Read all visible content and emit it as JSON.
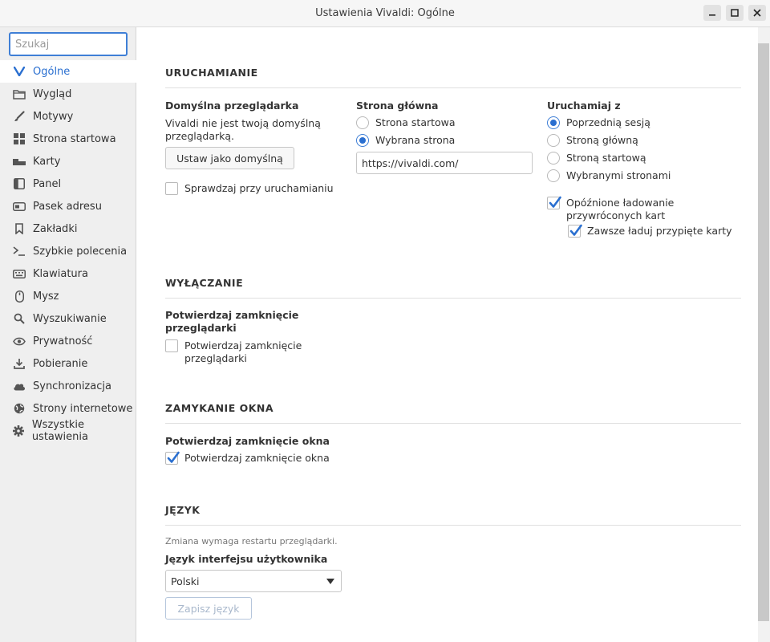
{
  "window": {
    "title": "Ustawienia Vivaldi: Ogólne",
    "minimize_icon": "minimize-icon",
    "maximize_icon": "maximize-icon",
    "close_icon": "close-icon"
  },
  "sidebar": {
    "search_placeholder": "Szukaj",
    "items": [
      {
        "label": "Ogólne",
        "icon": "vivaldi-icon",
        "active": true
      },
      {
        "label": "Wygląd",
        "icon": "folder-icon"
      },
      {
        "label": "Motywy",
        "icon": "brush-icon"
      },
      {
        "label": "Strona startowa",
        "icon": "grid-icon"
      },
      {
        "label": "Karty",
        "icon": "tabs-icon"
      },
      {
        "label": "Panel",
        "icon": "panel-icon"
      },
      {
        "label": "Pasek adresu",
        "icon": "address-bar-icon"
      },
      {
        "label": "Zakładki",
        "icon": "bookmark-icon"
      },
      {
        "label": "Szybkie polecenia",
        "icon": "command-icon"
      },
      {
        "label": "Klawiatura",
        "icon": "keyboard-icon"
      },
      {
        "label": "Mysz",
        "icon": "mouse-icon"
      },
      {
        "label": "Wyszukiwanie",
        "icon": "search-icon"
      },
      {
        "label": "Prywatność",
        "icon": "eye-icon"
      },
      {
        "label": "Pobieranie",
        "icon": "download-icon"
      },
      {
        "label": "Synchronizacja",
        "icon": "cloud-icon"
      },
      {
        "label": "Strony internetowe",
        "icon": "globe-icon"
      },
      {
        "label": "Wszystkie ustawienia",
        "icon": "gear-icon"
      }
    ]
  },
  "startup": {
    "heading": "URUCHAMIANIE",
    "default_browser": {
      "label": "Domyślna przeglądarka",
      "description": "Vivaldi nie jest twoją domyślną przeglądarką.",
      "button": "Ustaw jako domyślną",
      "check_label": "Sprawdzaj przy uruchamianiu",
      "check_on": false
    },
    "homepage": {
      "label": "Strona główna",
      "options": [
        "Strona startowa",
        "Wybrana strona"
      ],
      "selected": "Wybrana strona",
      "url": "https://vivaldi.com/"
    },
    "start_with": {
      "label": "Uruchamiaj z",
      "options": [
        "Poprzednią sesją",
        "Stroną główną",
        "Stroną startową",
        "Wybranymi stronami"
      ],
      "selected": "Poprzednią sesją",
      "lazy_load": "Opóźnione ładowanie przywróconych kart",
      "lazy_load_on": true,
      "load_pinned": "Zawsze ładuj przypięte karty",
      "load_pinned_on": true
    }
  },
  "shutdown": {
    "heading": "WYŁĄCZANIE",
    "label": "Potwierdzaj zamknięcie przeglądarki",
    "check_label": "Potwierdzaj zamknięcie przeglądarki",
    "check_on": false
  },
  "window_close": {
    "heading": "ZAMYKANIE OKNA",
    "label": "Potwierdzaj zamknięcie okna",
    "check_label": "Potwierdzaj zamknięcie okna",
    "check_on": true
  },
  "language": {
    "heading": "JĘZYK",
    "note": "Zmiana wymaga restartu przeglądarki.",
    "label": "Język interfejsu użytkownika",
    "selected": "Polski",
    "save_button": "Zapisz język"
  },
  "colors": {
    "accent": "#2a6fd0",
    "sidebar_bg": "#efefef"
  }
}
